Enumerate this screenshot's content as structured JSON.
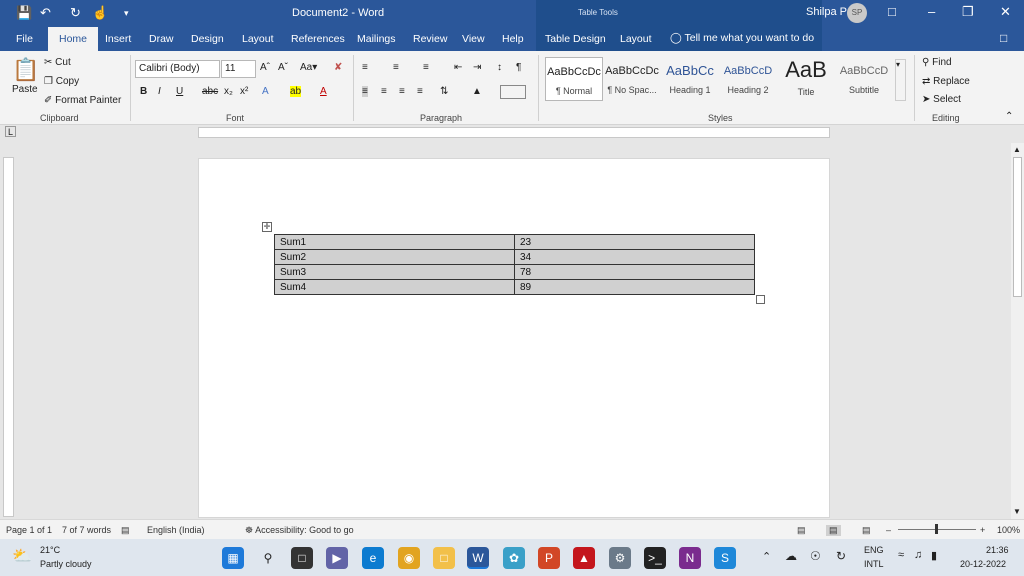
{
  "title": {
    "doc": "Document2",
    "sep": "-",
    "app": "Word",
    "table_tools": "Table Tools"
  },
  "user": {
    "name": "Shilpa P",
    "initials": "SP"
  },
  "tabs": [
    "File",
    "Home",
    "Insert",
    "Draw",
    "Design",
    "Layout",
    "References",
    "Mailings",
    "Review",
    "View",
    "Help",
    "Table Design",
    "Layout"
  ],
  "tellme": "Tell me what you want to do",
  "clipboard": {
    "paste": "Paste",
    "cut": "Cut",
    "copy": "Copy",
    "format_painter": "Format Painter",
    "label": "Clipboard"
  },
  "font": {
    "name": "Calibri (Body)",
    "size": "11",
    "label": "Font"
  },
  "paragraph": {
    "label": "Paragraph"
  },
  "styles": {
    "label": "Styles",
    "items": [
      {
        "preview": "AaBbCcDc",
        "name": "¶ Normal"
      },
      {
        "preview": "AaBbCcDc",
        "name": "¶ No Spac..."
      },
      {
        "preview": "AaBbCc",
        "name": "Heading 1"
      },
      {
        "preview": "AaBbCcD",
        "name": "Heading 2"
      },
      {
        "preview": "AaB",
        "name": "Title"
      },
      {
        "preview": "AaBbCcD",
        "name": "Subtitle"
      }
    ]
  },
  "editing": {
    "find": "Find",
    "replace": "Replace",
    "select": "Select",
    "label": "Editing"
  },
  "table": {
    "rows": [
      [
        "Sum1",
        "23"
      ],
      [
        "Sum2",
        "34"
      ],
      [
        "Sum3",
        "78"
      ],
      [
        "Sum4",
        "89"
      ]
    ]
  },
  "status": {
    "page": "Page 1 of 1",
    "words": "7 of 7 words",
    "language": "English (India)",
    "accessibility": "Accessibility: Good to go",
    "zoom": "100%"
  },
  "taskbar": {
    "temp": "21°C",
    "weather": "Partly cloudy",
    "lang1": "ENG",
    "lang2": "INTL",
    "time": "21:36",
    "date": "20-12-2022"
  },
  "colors": {
    "accent": "#2b579a",
    "accent_dark": "#1f4e8c",
    "table_fill": "#d0d0d0"
  }
}
